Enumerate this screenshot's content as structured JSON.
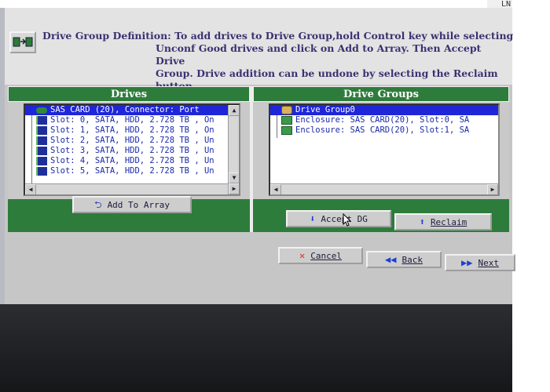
{
  "corner_text": "LN",
  "help": {
    "line1": "Drive Group Definition: To add drives to Drive Group,hold Control key while selecting",
    "line2": "Unconf Good drives and click on Add to Array. Then Accept Drive",
    "line3": "Group. Drive addition can be undone by selecting the Reclaim",
    "line4": "button."
  },
  "drives_panel": {
    "title": "Drives",
    "items": [
      {
        "label": "SAS CARD (20), Connector: Port",
        "selected": true
      },
      {
        "label": "Slot: 0, SATA, HDD, 2.728 TB , On"
      },
      {
        "label": "Slot: 1, SATA, HDD, 2.728 TB , On"
      },
      {
        "label": "Slot: 2, SATA, HDD, 2.728 TB , Un"
      },
      {
        "label": "Slot: 3, SATA, HDD, 2.728 TB , Un"
      },
      {
        "label": "Slot: 4, SATA, HDD, 2.728 TB , Un"
      },
      {
        "label": "Slot: 5, SATA, HDD, 2.728 TB , Un"
      }
    ],
    "add_button": "Add To Array"
  },
  "groups_panel": {
    "title": "Drive Groups",
    "items": [
      {
        "label": "Drive Group0",
        "selected": true
      },
      {
        "label": "Enclosure: SAS CARD(20), Slot:0, SA"
      },
      {
        "label": "Enclosure: SAS CARD(20), Slot:1, SA"
      }
    ],
    "accept_button": "Accept DG",
    "reclaim_button": "Reclaim"
  },
  "nav": {
    "cancel": "Cancel",
    "back": "Back",
    "next": "Next"
  },
  "colors": {
    "panel_green": "#2e7c3c",
    "selection_blue": "#1f26d8",
    "help_text": "#3a3170"
  }
}
